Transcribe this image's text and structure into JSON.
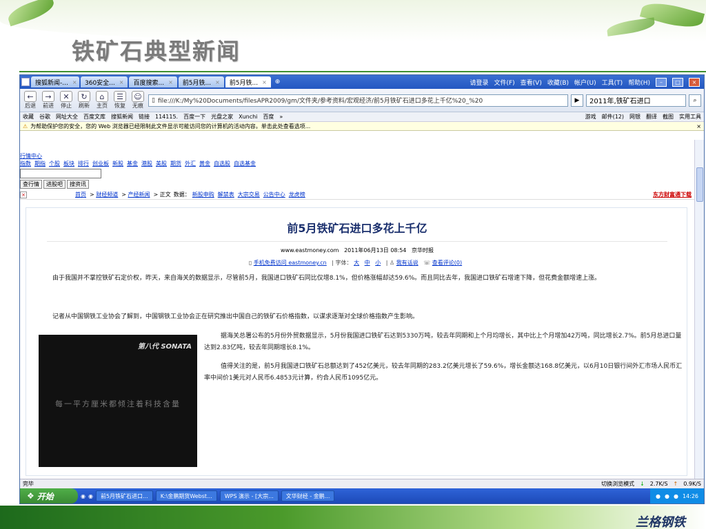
{
  "slide": {
    "title": "铁矿石典型新闻",
    "footer_logo": "兰格钢铁"
  },
  "browser": {
    "tabs": [
      {
        "label": "搜狐新闻-..."
      },
      {
        "label": "360安全..."
      },
      {
        "label": "百度搜索..."
      },
      {
        "label": "前5月铁..."
      },
      {
        "label": "前5月铁..."
      }
    ],
    "menu": [
      "请登录",
      "文件(F)",
      "查看(V)",
      "收藏(B)",
      "帐户(U)",
      "工具(T)",
      "帮助(H)"
    ],
    "nav": {
      "back": "后退",
      "forward": "前进",
      "stop": "停止",
      "refresh": "刷新",
      "home": "主页",
      "restore": "恢复",
      "no_trace": "无痕"
    },
    "address": "file:///K:/My%20Documents/filesAPR2009/gm/文件夹/参考资料/宏观经济/前5月铁矿石进口多花上千亿%20_%20",
    "search_value": "2011年,铁矿石进口",
    "favorites": [
      "收藏",
      "谷歌",
      "网址大全",
      "百度文库",
      "搜狐新闻",
      "链接",
      "114115.",
      "百度一下",
      "光盘之家",
      "Xunchi",
      "百度"
    ],
    "favorites_right": [
      "游戏",
      "邮件(12)",
      "网银",
      "翻译",
      "截图",
      "实用工具"
    ],
    "infobar": "为帮助保护您的安全，您的 Web 浏览器已经限制此文件显示可能访问您的计算机的活动内容。单击此处查看选项..."
  },
  "page": {
    "top_link": "行情中心",
    "links": [
      "指数",
      "期指",
      "个股",
      "板块",
      "排行",
      "创业板",
      "新股",
      "基金",
      "港股",
      "美股",
      "期货",
      "外汇",
      "黄金",
      "自选股",
      "自选基金"
    ],
    "buttons": [
      "查行情",
      "进股吧",
      "搜资讯"
    ],
    "crumbs": [
      "首页",
      "财经频道",
      "产经新闻"
    ],
    "crumb_current": "正文",
    "data_label": "数据：",
    "data_links": [
      "新股申购",
      "解禁表",
      "大宗交易",
      "公告中心",
      "龙虎榜"
    ],
    "east_logo": "东方财富通下载"
  },
  "article": {
    "title": "前5月铁矿石进口多花上千亿",
    "source_url": "www.eastmoney.com",
    "datetime": "2011年06月13日 08:54",
    "source": "京华时报",
    "mobile_link": "手机免费访问 eastmoney.cn",
    "font_label": "字体：",
    "font_sizes": [
      "大",
      "中",
      "小"
    ],
    "comment_link": "我有话说",
    "view_comments": "查看评论(0)",
    "paragraphs": [
      "由于我国并不掌控铁矿石定价权，昨天，来自海关的数据显示，尽管前5月，我国进口铁矿石同比仅增8.1%，但价格涨幅却达59.6%。而且同比去年，我国进口铁矿石增速下降，但花费金额增速上涨。",
      "记者从中国钢铁工业协会了解到，中国钢铁工业协会正在研究推出中国自己的铁矿石价格指数，以谋求逐渐对全球价格指数产生影响。",
      "据海关总署公布的5月份外贸数据显示，5月份我国进口铁矿石达到5330万吨，较去年同期和上个月均增长，其中比上个月增加42万吨，同比增长2.7%。前5月总进口量达到2.83亿吨，较去年同期增长8.1%。",
      "值得关注的是，前5月我国进口铁矿石总额达到了452亿美元，较去年同期的283.2亿美元增长了59.6%，增长金额达168.8亿美元，以6月10日银行间外汇市场人民币汇率中间价1美元对人民币6.4853元计算，约合人民币1095亿元。"
    ],
    "ad_logo": "第八代 SONATA",
    "ad_slogan": "每一平方厘米都倾注着科技含量"
  },
  "status": {
    "done": "完毕",
    "mode": "切换浏览模式",
    "down_speed": "2.7K/S",
    "up_speed": "0.9K/S"
  },
  "taskbar": {
    "start": "开始",
    "tasks": [
      "前5月铁矿石进口...",
      "K:\\金鹏期货Webst...",
      "WPS 演示 - [大宗...",
      "文华财经 - 金鹏..."
    ],
    "clock": "14:26"
  }
}
